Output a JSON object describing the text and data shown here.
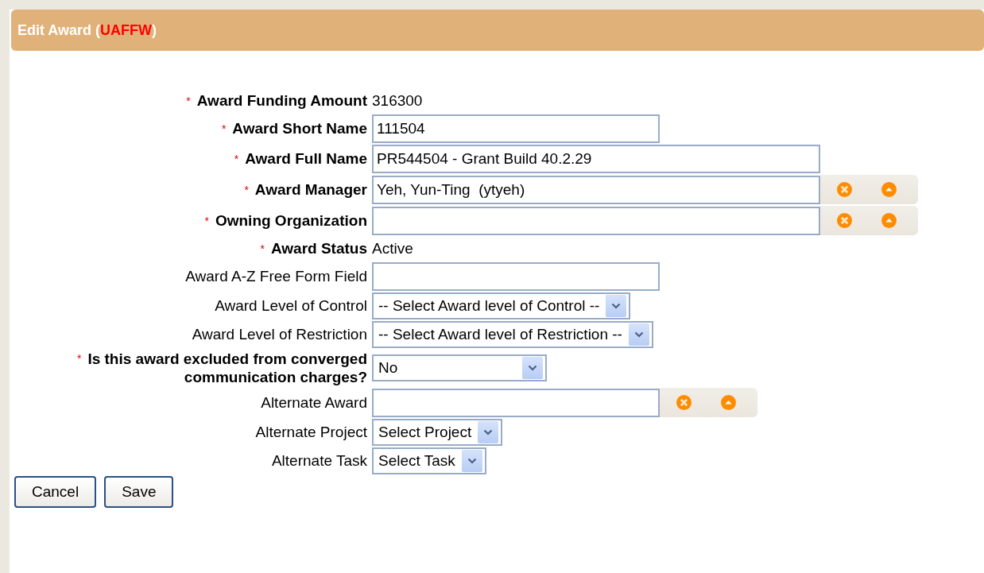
{
  "header": {
    "title": "Edit Award (**UAFFW**)"
  },
  "fields": [
    {
      "kind": "text",
      "asterisk": "*",
      "label": "Award Funding Amount",
      "required": true,
      "value": "316300"
    },
    {
      "kind": "input",
      "asterisk": "*",
      "label": "Award Short Name",
      "required": true,
      "value": "111504"
    },
    {
      "kind": "input",
      "asterisk": "*",
      "label": "Award Full Name",
      "required": true,
      "value": "PR544504 - Grant Build 40.2.29"
    },
    {
      "kind": "lookup",
      "asterisk": "*",
      "label": "Award Manager",
      "required": true,
      "value": "Yeh, Yun-Ting  (ytyeh)"
    },
    {
      "kind": "lookup",
      "asterisk": "*",
      "label": "Owning Organization",
      "required": true
    },
    {
      "kind": "text",
      "asterisk": "*",
      "label": "Award Status",
      "required": true,
      "value": "Active"
    },
    {
      "kind": "input",
      "label": "Award A-Z Free Form Field",
      "required": false
    },
    {
      "kind": "select",
      "label": "Award Level of Control",
      "required": false,
      "value": "-- Select Award level of Control --"
    },
    {
      "kind": "select",
      "label": "Award Level of Restriction",
      "required": false,
      "value": "-- Select Award level of Restriction --"
    },
    {
      "kind": "select",
      "asterisk": "*",
      "label": "Is this award excluded from converged communication charges?",
      "required": true,
      "value": "No"
    },
    {
      "kind": "lookup",
      "label": "Alternate Award",
      "required": false
    },
    {
      "kind": "select",
      "label": "Alternate Project",
      "required": false,
      "value": "Select Project"
    },
    {
      "kind": "select",
      "label": "Alternate Task",
      "required": false,
      "value": "Select Task"
    }
  ],
  "buttons": [
    "Cancel",
    "Save"
  ]
}
